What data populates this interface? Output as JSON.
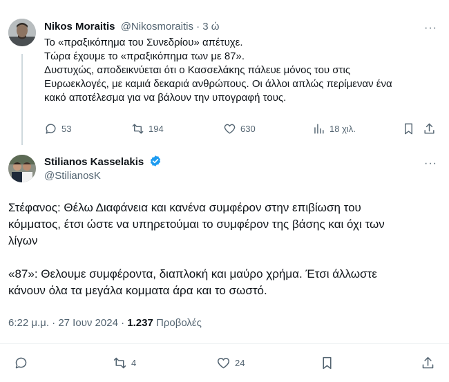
{
  "reply": {
    "author_name": "Nikos Moraitis",
    "handle": "@Nikosmoraitis",
    "separator": "·",
    "time": "3 ώ",
    "lines": [
      "Το «πραξικόπημα του Συνεδρίου» απέτυχε.",
      "Τώρα έχουμε το «πραξικόπημα των με 87».",
      "Δυστυχώς, αποδεικνύεται ότι ο Κασσελάκης πάλευε μόνος του στις",
      "Ευρωεκλογές, με καμιά δεκαριά ανθρώπους. Οι άλλοι απλώς περίμεναν ένα",
      "κακό αποτέλεσμα για να βάλουν την υπογραφή τους."
    ],
    "actions": {
      "replies": "53",
      "reposts": "194",
      "likes": "630",
      "views": "18 χιλ."
    },
    "more": "···"
  },
  "main": {
    "author_name": "Stilianos Kasselakis",
    "handle": "@StilianosK",
    "more": "···",
    "paragraph1": [
      "Στέφανος: Θέλω Διαφάνεια και κανένα συμφέρον στην επιβίωση του",
      "κόμματος, έτσι ώστε να υπηρετούμαι το συμφέρον της βάσης και όχι των",
      "λίγων"
    ],
    "paragraph2": [
      "«87»: Θελουμε συμφέροντα, διαπλοκή και μαύρο χρήμα. Έτσι άλλωστε",
      "κάνουν όλα τα μεγάλα κομματα άρα και το σωστό."
    ],
    "meta": {
      "time": "6:22 μ.μ.",
      "sep": "·",
      "date": "27 Ιουν 2024",
      "sep2": "·",
      "views_count": "1.237",
      "views_label": "Προβολές"
    },
    "actions": {
      "replies": "",
      "reposts": "4",
      "likes": "24"
    }
  },
  "colors": {
    "text": "#0f1419",
    "muted": "#536471",
    "verified": "#1d9bf0",
    "divider": "#eff3f4"
  }
}
